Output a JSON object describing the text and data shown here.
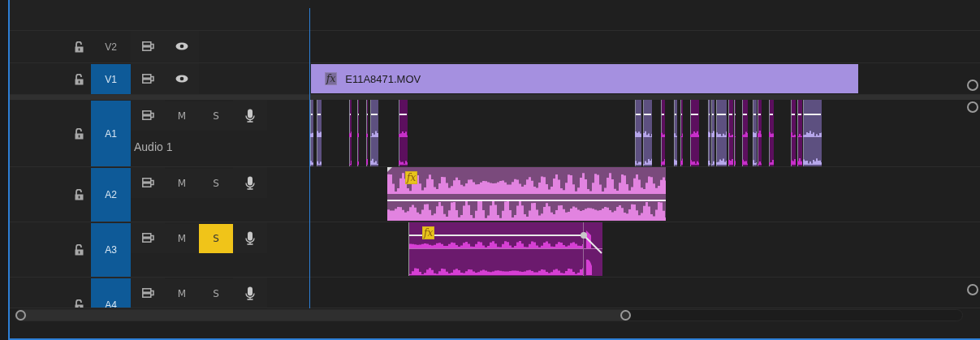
{
  "tracks": [
    {
      "kind": "video",
      "label": "V2",
      "targeted": false,
      "locked": false,
      "visible": true
    },
    {
      "kind": "video",
      "label": "V1",
      "targeted": true,
      "locked": false,
      "visible": true,
      "clips": [
        {
          "kind": "video",
          "name": "E11A8471.MOV",
          "badge": "fx",
          "effects_applied": false
        }
      ]
    },
    {
      "kind": "audio",
      "label": "A1",
      "name": "Audio 1",
      "targeted": true,
      "locked": false,
      "mute": false,
      "solo": false,
      "mute_label": "M",
      "solo_label": "S",
      "clips": [
        {
          "kind": "segments"
        }
      ]
    },
    {
      "kind": "audio",
      "label": "A2",
      "targeted": true,
      "locked": false,
      "mute": false,
      "solo": false,
      "mute_label": "M",
      "solo_label": "S",
      "clips": [
        {
          "kind": "stereo",
          "badge": "fx",
          "effects_applied": true
        }
      ]
    },
    {
      "kind": "audio",
      "label": "A3",
      "targeted": true,
      "locked": false,
      "mute": false,
      "solo": true,
      "mute_label": "M",
      "solo_label": "S",
      "clips": [
        {
          "kind": "keyed",
          "badge": "fx",
          "effects_applied": true
        }
      ]
    },
    {
      "kind": "audio",
      "label": "A4",
      "targeted": true,
      "locked": false,
      "mute": false,
      "solo": false,
      "mute_label": "M",
      "solo_label": "S"
    }
  ]
}
